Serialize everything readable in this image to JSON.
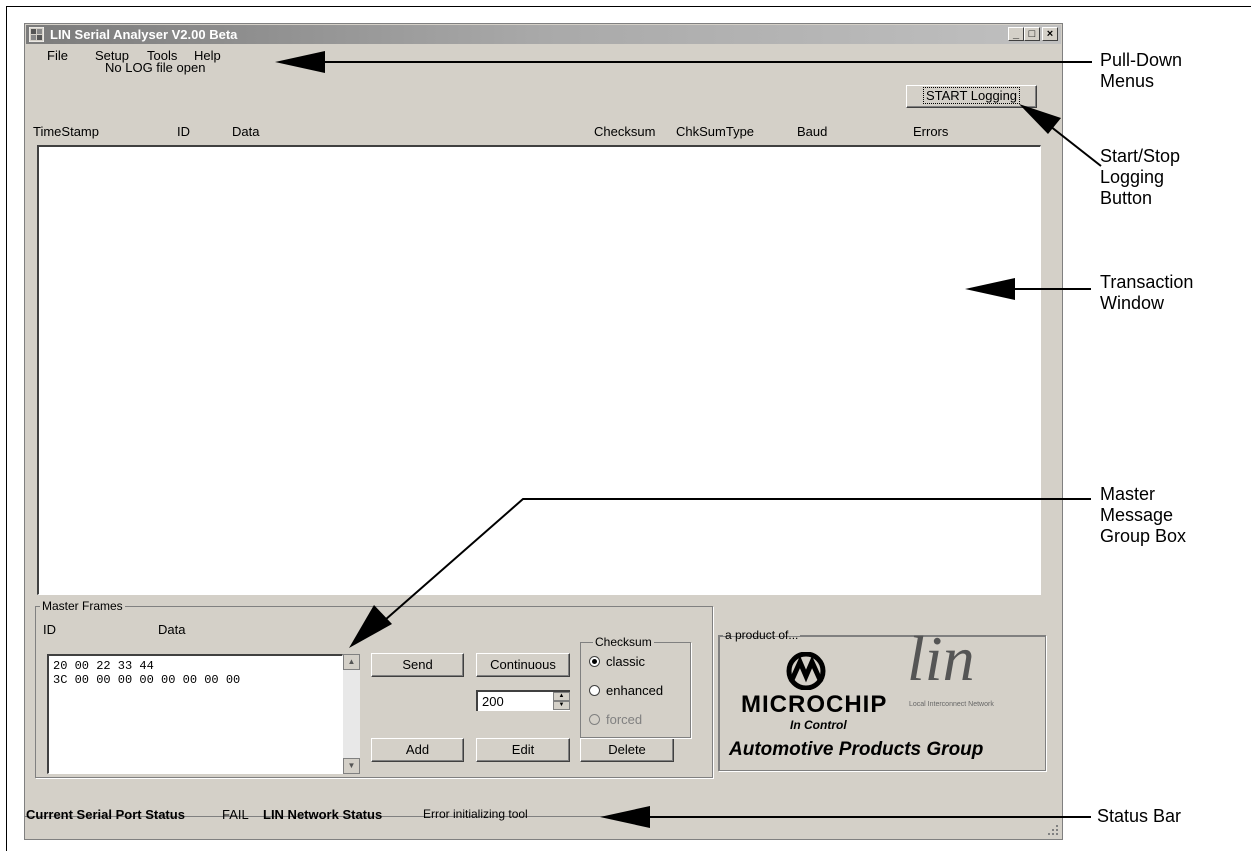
{
  "window": {
    "title": "LIN Serial Analyser V2.00 Beta",
    "controls": {
      "minimize": "_",
      "maximize": "□",
      "close": "×"
    }
  },
  "menubar": {
    "items": [
      "File",
      "Setup",
      "Tools",
      "Help"
    ]
  },
  "log": {
    "status": "No LOG file open",
    "start_button": "START Logging"
  },
  "table": {
    "headers": [
      "TimeStamp",
      "ID",
      "Data",
      "Checksum",
      "ChkSumType",
      "Baud",
      "Errors"
    ]
  },
  "master": {
    "legend": "Master Frames",
    "col_id": "ID",
    "col_data": "Data",
    "frames": [
      "20 00 22 33 44",
      "3C 00 00 00 00 00 00 00 00"
    ],
    "send": "Send",
    "continuous": "Continuous",
    "interval": "200",
    "add": "Add",
    "edit": "Edit",
    "delete": "Delete",
    "checksum": {
      "legend": "Checksum",
      "options": [
        "classic",
        "enhanced",
        "forced"
      ],
      "selected": "classic"
    }
  },
  "product": {
    "legend": "a product of...",
    "brand": "MICROCHIP",
    "tagline": "In Control",
    "lin_logo": "lin",
    "lin_sub": "Local Interconnect Network",
    "group": "Automotive Products Group"
  },
  "statusbar": {
    "serial_label": "Current Serial Port Status",
    "serial_value": "FAIL",
    "network_label": "LIN Network Status",
    "network_value": "Error initializing tool"
  },
  "annotations": {
    "menus": [
      "Pull-Down",
      "Menus"
    ],
    "logging": [
      "Start/Stop",
      "Logging",
      "Button"
    ],
    "transaction": [
      "Transaction",
      "Window"
    ],
    "master": [
      "Master",
      "Message",
      "Group Box"
    ],
    "status": "Status Bar"
  }
}
